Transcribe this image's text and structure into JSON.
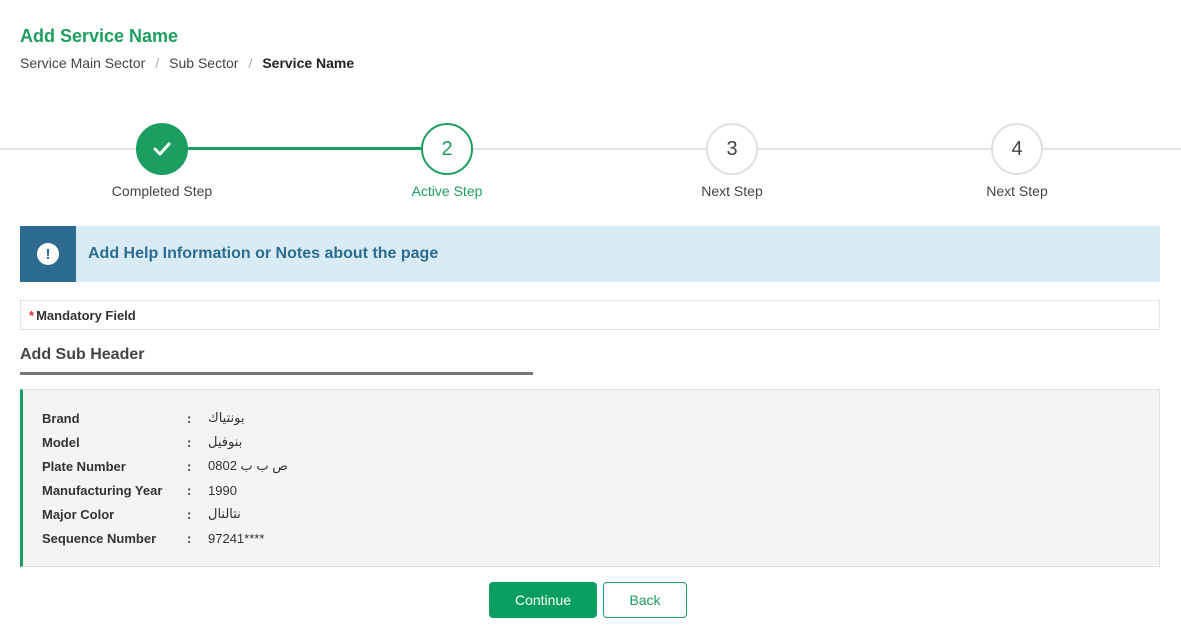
{
  "header": {
    "title": "Add Service Name",
    "breadcrumb": [
      "Service Main Sector",
      "Sub Sector",
      "Service Name"
    ]
  },
  "stepper": {
    "steps": [
      {
        "number": "",
        "label": "Completed Step",
        "state": "completed",
        "icon": "check-icon"
      },
      {
        "number": "2",
        "label": "Active Step",
        "state": "active"
      },
      {
        "number": "3",
        "label": "Next Step",
        "state": "next"
      },
      {
        "number": "4",
        "label": "Next Step",
        "state": "next"
      }
    ]
  },
  "help": {
    "icon": "exclamation-icon",
    "text": "Add Help Information or Notes about the page"
  },
  "mandatory": {
    "star": "*",
    "label": "Mandatory Field"
  },
  "sub_header": "Add Sub Header",
  "details": [
    {
      "label": "Brand",
      "separator": ":",
      "value": "بونتياك"
    },
    {
      "label": "Model",
      "separator": ":",
      "value": "بنوفيل"
    },
    {
      "label": "Plate Number",
      "separator": ":",
      "value": "ص ب ب 0802"
    },
    {
      "label": "Manufacturing Year",
      "separator": ":",
      "value": "1990"
    },
    {
      "label": "Major Color",
      "separator": ":",
      "value": "نتالنال"
    },
    {
      "label": "Sequence Number",
      "separator": ":",
      "value": "97241****"
    }
  ],
  "actions": {
    "continue_label": "Continue",
    "back_label": "Back"
  },
  "colors": {
    "accent_green": "#1b9e5f",
    "help_blue": "#2e6b90",
    "help_bg": "#d9ecf6"
  }
}
